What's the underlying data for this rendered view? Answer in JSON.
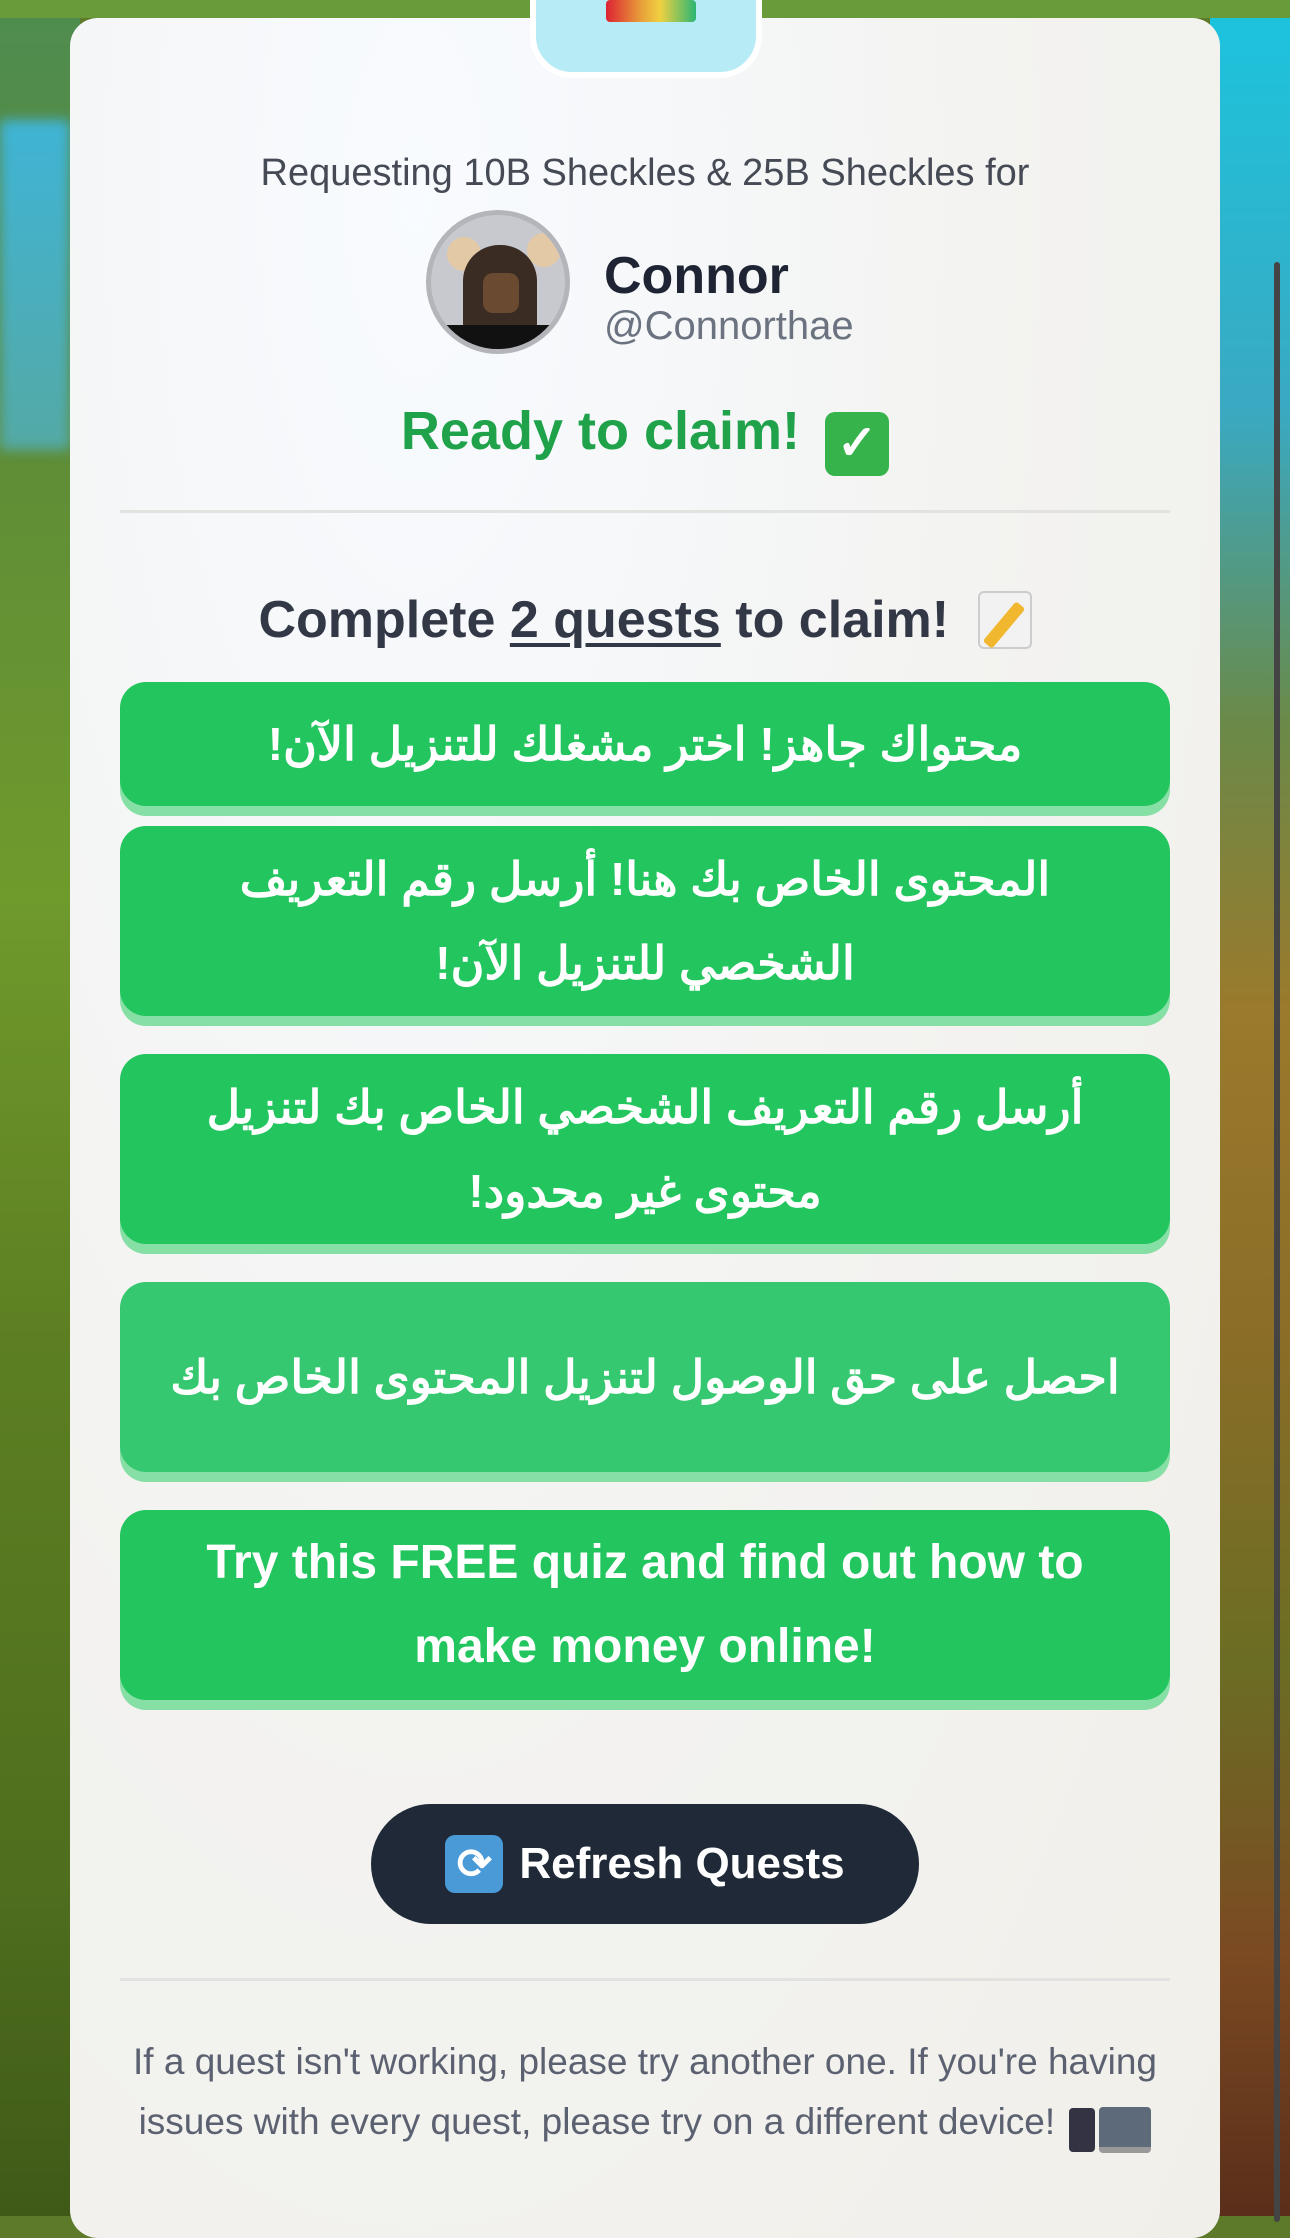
{
  "header": {
    "request_text": "Requesting 10B Sheckles & 25B Sheckles for"
  },
  "user": {
    "name": "Connor",
    "handle": "@Connorthae"
  },
  "status": {
    "text": "Ready to claim!",
    "icon": "check-mark-icon",
    "icon_glyph": "✓"
  },
  "quests_header": {
    "prefix": "Complete ",
    "link": "2 quests",
    "suffix": " to claim!",
    "icon": "pencil-memo-icon"
  },
  "quests": [
    {
      "label": "محتواك جاهز! اختر مشغلك للتنزيل الآن!"
    },
    {
      "label": "المحتوى الخاص بك هنا! أرسل رقم التعريف الشخصي للتنزيل الآن!"
    },
    {
      "label": "أرسل رقم التعريف الشخصي الخاص بك لتنزيل محتوى غير محدود!"
    },
    {
      "label": "احصل على حق الوصول لتنزيل المحتوى الخاص بك"
    },
    {
      "label": "Try this FREE quiz and find out how to make money online!"
    }
  ],
  "refresh": {
    "label": "Refresh Quests",
    "icon": "refresh-icon",
    "icon_glyph": "⟳"
  },
  "footer": {
    "text": "If a quest isn't working, please try another one. If you're having issues with every quest, please try on a different device!",
    "icons": [
      "phone-icon",
      "monitor-icon"
    ]
  },
  "colors": {
    "quest_green": "#22c55e",
    "status_green": "#1fa24a",
    "dark_button": "#1f2937"
  }
}
